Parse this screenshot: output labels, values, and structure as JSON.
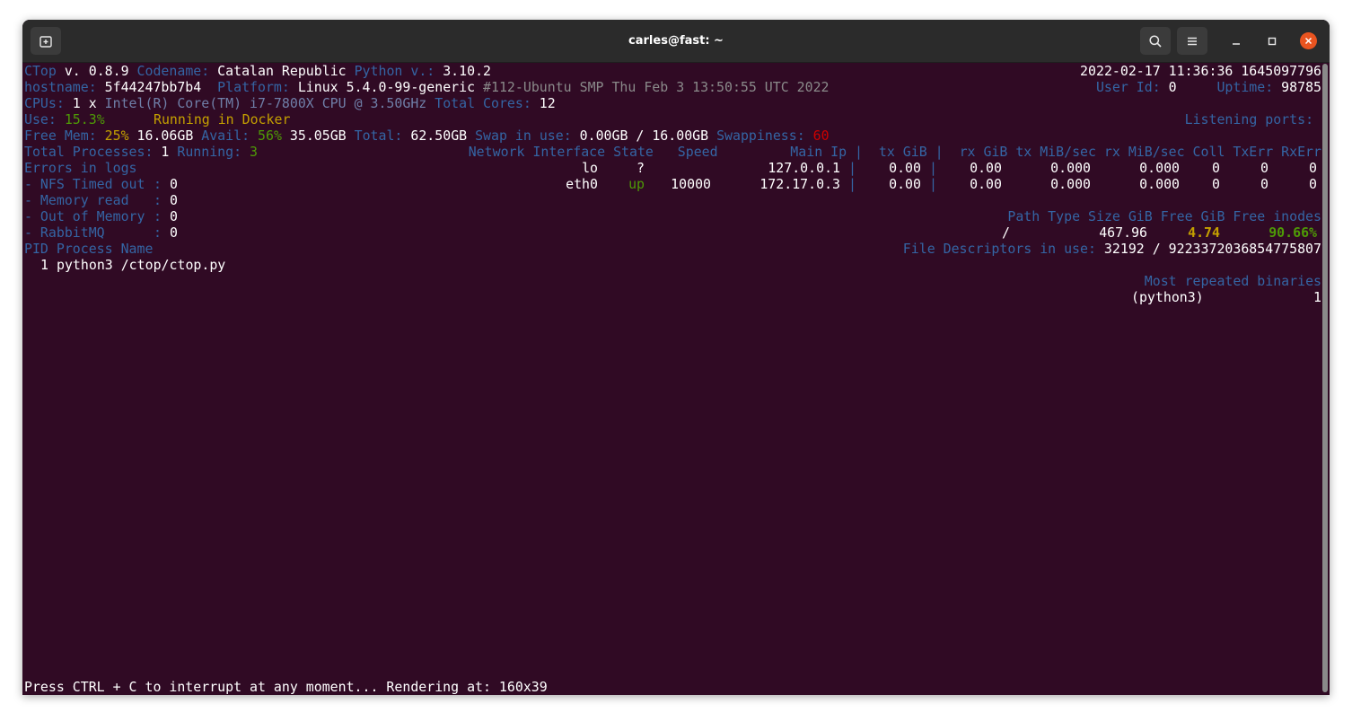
{
  "window": {
    "title": "carles@fast: ~"
  },
  "term": {
    "l1": {
      "ctop": "CTop",
      "ver": " v. 0.8.9 ",
      "codename_lbl": "Codename:",
      "codename": " Catalan Republic ",
      "py_lbl": "Python v.:",
      "py": " 3.10.2",
      "dt": "2022-02-17 11:36:36 1645097796"
    },
    "l2": {
      "host_lbl": "hostname:",
      "host": " 5f44247bb7b4  ",
      "plat_lbl": "Platform:",
      "plat": " Linux 5.4.0-99-generic ",
      "kern": "#112-Ubuntu SMP Thu Feb 3 13:50:55 UTC 2022",
      "uid_lbl": "User Id:",
      "uid": " 0     ",
      "up_lbl": "Uptime:",
      "up": " 98785"
    },
    "l3": {
      "cpus_lbl": "CPUs:",
      "cpus": " 1 x ",
      "cpu": "Intel(R) Core(TM) i7-7800X CPU @ 3.50GHz",
      "sp": " ",
      "tc_lbl": "Total Cores:",
      "tc": " 12"
    },
    "l4": {
      "use_lbl": "Use:",
      "use": " 15.3%",
      "docker": "Running in Docker",
      "lp": "Listening ports: "
    },
    "l5": {
      "fm_lbl": "Free Mem:",
      "fm_pct": " 25%",
      "fm": " 16.06GB ",
      "av_lbl": "Avail:",
      "av_pct": " 56%",
      "av": " 35.05GB ",
      "tot_lbl": "Total:",
      "tot": " 62.50GB ",
      "sw_lbl": "Swap in use:",
      "sw": " 0.00GB / 16.00GB ",
      "swp_lbl": "Swappiness:",
      "swp": " 60"
    },
    "l6": {
      "tp_lbl": "Total Processes:",
      "tp": " 1 ",
      "run_lbl": "Running:",
      "run": " 3"
    },
    "net_header": "Network Interface State   Speed         Main Ip |  tx GiB |  rx GiB tx MiB/sec rx MiB/sec Coll TxErr RxErr",
    "net_rows": [
      {
        "ifc": "lo",
        "state": "?",
        "speed": "",
        "ip": "127.0.0.1",
        "tx": "0.00",
        "rx": "0.00",
        "txs": "0.000",
        "rxs": "0.000",
        "coll": "0",
        "txe": "0",
        "rxe": "0"
      },
      {
        "ifc": "eth0",
        "state": "up",
        "speed": "10000",
        "ip": "172.17.0.3",
        "tx": "0.00",
        "rx": "0.00",
        "txs": "0.000",
        "rxs": "0.000",
        "coll": "0",
        "txe": "0",
        "rxe": "0"
      }
    ],
    "errors": {
      "title": "Errors in logs",
      "items": [
        {
          "label": "- NFS Timed out",
          "value": "0"
        },
        {
          "label": "- Memory read",
          "value": "0"
        },
        {
          "label": "- Out of Memory",
          "value": "0"
        },
        {
          "label": "- RabbitMQ",
          "value": "0"
        }
      ]
    },
    "disk": {
      "header": "Path Type Size GiB Free GiB Free inodes",
      "path": "/",
      "size": "467.96",
      "free": "4.74",
      "inodes": "90.66%"
    },
    "fd": {
      "lbl": "File Descriptors in use:",
      "val": " 32192 / 9223372036854775807"
    },
    "proc": {
      "header": "PID Process Name",
      "pid": "1",
      "name": "python3 /ctop/ctop.py"
    },
    "bin": {
      "header": "Most repeated binaries",
      "name": "(python3)",
      "count": "1"
    },
    "footer": "Press CTRL + C to interrupt at any moment... Rendering at: 160x39"
  },
  "colors": {
    "terminal_bg": "#300a24",
    "blue": "#3465a4",
    "green": "#4e9a06",
    "yellow": "#c4a000",
    "red": "#cc0000",
    "close": "#e95420"
  },
  "icons": [
    "new-tab-icon",
    "search-icon",
    "hamburger-menu-icon",
    "minimize-icon",
    "maximize-icon",
    "close-icon"
  ]
}
